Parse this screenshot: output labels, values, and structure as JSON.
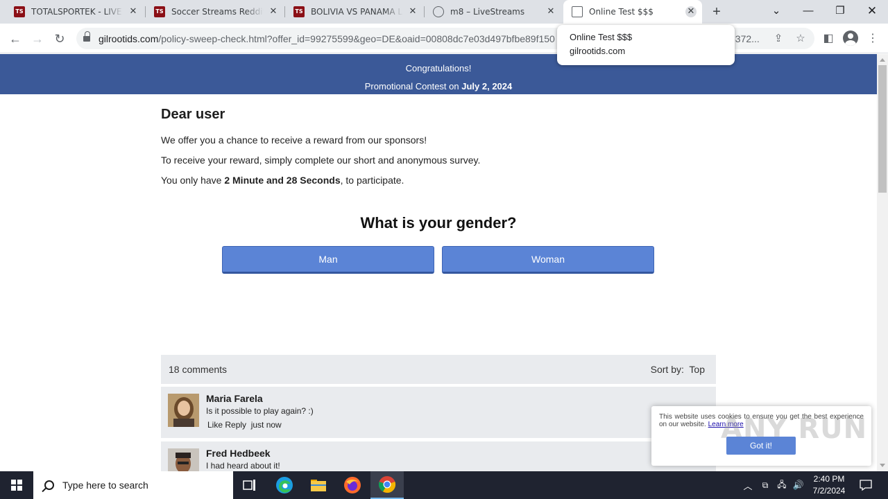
{
  "browser": {
    "tabs": [
      {
        "title": "TOTALSPORTEK - LIVE STR",
        "favicon": "ts-icon",
        "active": false
      },
      {
        "title": "Soccer Streams Reddit - T",
        "favicon": "ts-icon",
        "active": false
      },
      {
        "title": "BOLIVIA VS PANAMA Live",
        "favicon": "ts-icon",
        "active": false
      },
      {
        "title": "m8 – LiveStreams",
        "favicon": "globe-icon",
        "active": false
      },
      {
        "title": "Online Test $$$",
        "favicon": "document-icon",
        "active": true
      }
    ],
    "favicon_text": "TS",
    "url_host": "gilrootids.com",
    "url_path": "/policy-sweep-check.html?offer_id=99275599&geo=DE&oaid=00808dc7e03d497bfbe89f150",
    "url_tail": "5372...",
    "hovercard": {
      "title": "Online Test $$$",
      "domain": "gilrootids.com"
    }
  },
  "banner": {
    "line1": "Congratulations!",
    "line2_prefix": "Promotional Contest on ",
    "line2_date": "July 2, 2024",
    "color": "#3b5998"
  },
  "content": {
    "greeting": "Dear user",
    "para1": "We offer you a chance to receive a reward from our sponsors!",
    "para2": "To receive your reward, simply complete our short and anonymous survey.",
    "para3_prefix": "You only have ",
    "para3_time": "2 Minute and 28 Seconds",
    "para3_suffix": ", to participate.",
    "question": "What is your gender?",
    "answers": [
      "Man",
      "Woman"
    ],
    "button_color": "#5b84d6"
  },
  "comments": {
    "count_label": "18 comments",
    "sort_label": "Sort by:",
    "sort_value": "Top",
    "items": [
      {
        "name": "Maria Farela",
        "text": "Is it possible to play again? :)",
        "actions": "Like Reply",
        "time": "just now"
      },
      {
        "name": "Fred Hedbeek",
        "text": "I had heard about it!",
        "actions": "",
        "time": ""
      }
    ]
  },
  "cookie": {
    "text": "This website uses cookies to ensure you get the best experience on our website.",
    "link": "Learn more",
    "button": "Got it!",
    "watermark": "ANY RUN"
  },
  "taskbar": {
    "search_placeholder": "Type here to search",
    "time": "2:40 PM",
    "date": "7/2/2024"
  }
}
